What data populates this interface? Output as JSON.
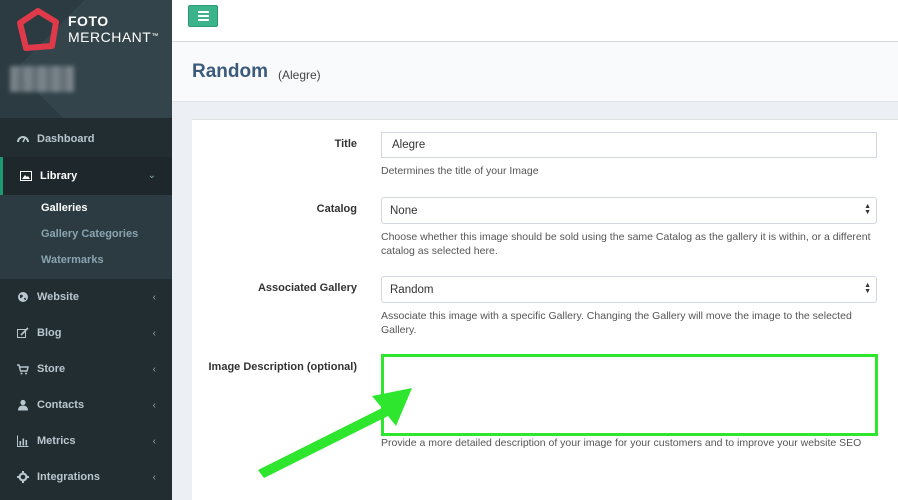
{
  "brand": {
    "line1": "FOTO",
    "line2": "MERCHANT",
    "tm": "™",
    "logo_color": "#e0394a"
  },
  "colors": {
    "accent": "#3cb38a",
    "highlight": "#2ee62e",
    "sidebar_bg": "#222d32"
  },
  "sidebar": {
    "items": [
      {
        "label": "Dashboard",
        "icon": "dashboard-icon"
      },
      {
        "label": "Library",
        "icon": "image-icon",
        "expanded": true,
        "children": [
          {
            "label": "Galleries",
            "current": true
          },
          {
            "label": "Gallery Categories"
          },
          {
            "label": "Watermarks"
          }
        ]
      },
      {
        "label": "Website",
        "icon": "globe-icon"
      },
      {
        "label": "Blog",
        "icon": "edit-icon"
      },
      {
        "label": "Store",
        "icon": "cart-icon"
      },
      {
        "label": "Contacts",
        "icon": "user-icon"
      },
      {
        "label": "Metrics",
        "icon": "bar-chart-icon"
      },
      {
        "label": "Integrations",
        "icon": "gear-icon"
      }
    ]
  },
  "header": {
    "title": "Random",
    "subtitle": "(Alegre)"
  },
  "form": {
    "title": {
      "label": "Title",
      "value": "Alegre",
      "help": "Determines the title of your Image"
    },
    "catalog": {
      "label": "Catalog",
      "value": "None",
      "help": "Choose whether this image should be sold using the same Catalog as the gallery it is within, or a different catalog as selected here."
    },
    "gallery": {
      "label": "Associated Gallery",
      "value": "Random",
      "help": "Associate this image with a specific Gallery. Changing the Gallery will move the image to the selected Gallery."
    },
    "description": {
      "label": "Image Description (optional)",
      "value": "",
      "help": "Provide a more detailed description of your image for your customers and to improve your website SEO"
    }
  }
}
